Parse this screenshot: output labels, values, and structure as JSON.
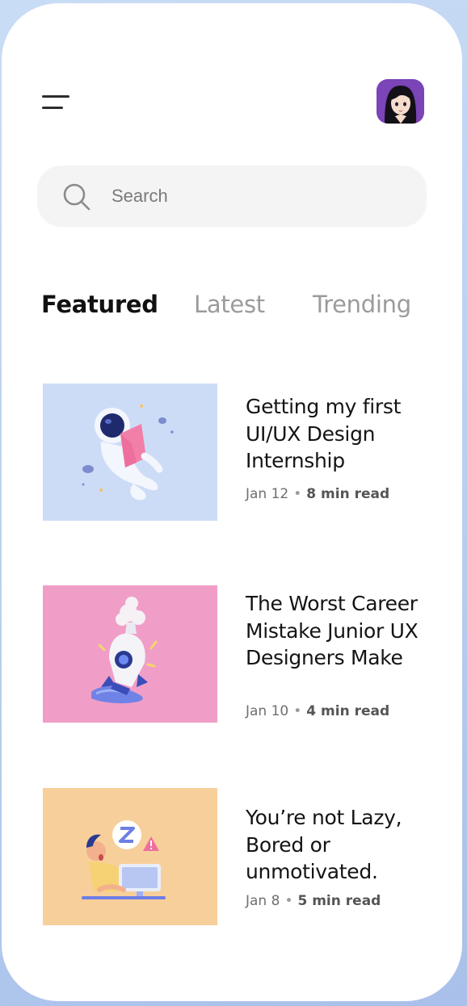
{
  "header": {
    "menu_icon": "hamburger-menu-icon",
    "avatar_icon": "user-avatar"
  },
  "search": {
    "placeholder": "Search",
    "icon": "search-icon"
  },
  "tabs": [
    {
      "label": "Featured",
      "active": true
    },
    {
      "label": "Latest",
      "active": false
    },
    {
      "label": "Trending",
      "active": false
    }
  ],
  "articles": [
    {
      "title": "Getting my first UI/UX Design Internship",
      "date": "Jan 12",
      "read_time": "8 min read",
      "image_icon": "astronaut-reading-illustration",
      "image_bg": "#cddcf6"
    },
    {
      "title": "The Worst Career Mistake Junior UX Designers Make",
      "date": "Jan 10",
      "read_time": "4 min read",
      "image_icon": "crashed-rocket-illustration",
      "image_bg": "#f09ec8"
    },
    {
      "title": "You’re not Lazy, Bored or unmotivated.",
      "date": "Jan 8",
      "read_time": "5 min read",
      "image_icon": "sleepy-person-at-computer-illustration",
      "image_bg": "#f7cf9b"
    }
  ],
  "colors": {
    "background": "#c2d6f4",
    "card": "#ffffff",
    "search_bg": "#f4f4f4",
    "active_tab": "#111111",
    "inactive_tab": "#9b9b9b"
  }
}
